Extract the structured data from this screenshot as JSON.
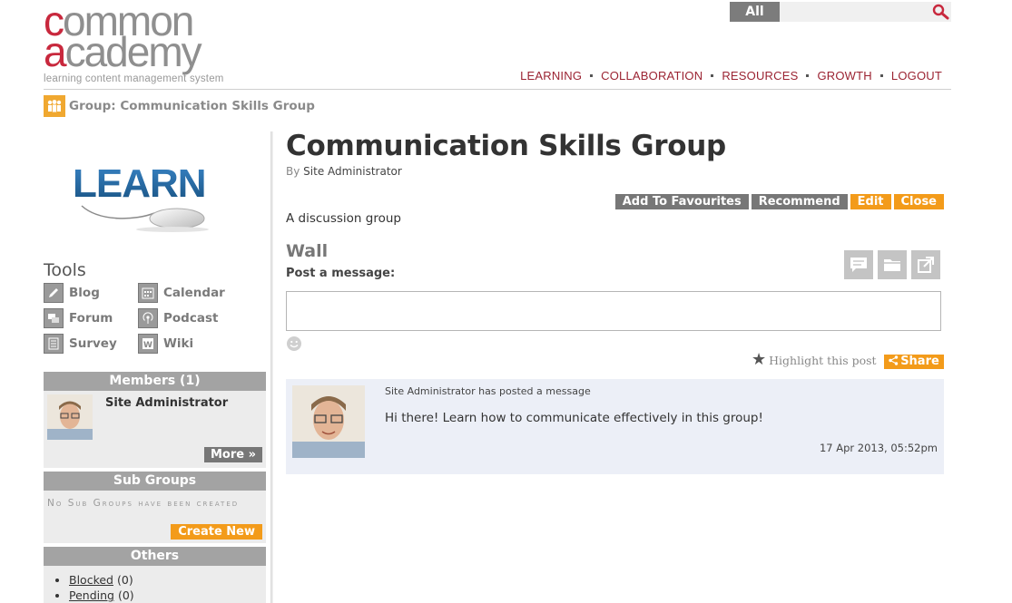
{
  "brand": {
    "logo_line1_initial": "c",
    "logo_line1_rest": "ommon",
    "logo_line2_initial": "a",
    "logo_line2_rest": "cademy",
    "tagline": "learning content management system",
    "accent_red": "#c8283d",
    "accent_orange": "#f39b1a"
  },
  "search": {
    "scope": "All",
    "value": "",
    "placeholder": ""
  },
  "nav": {
    "learning": "LEARNING",
    "collaboration": "COLLABORATION",
    "resources": "RESOURCES",
    "growth": "GROWTH",
    "logout": "LOGOUT"
  },
  "breadcrumb": {
    "text": "Group: Communication Skills Group",
    "icon": "group-icon"
  },
  "sidebar": {
    "banner_icon": "learn-mouse-banner",
    "tools_title": "Tools",
    "tools": [
      {
        "label": "Blog",
        "icon": "blog-icon"
      },
      {
        "label": "Calendar",
        "icon": "calendar-icon"
      },
      {
        "label": "Forum",
        "icon": "forum-icon"
      },
      {
        "label": "Podcast",
        "icon": "podcast-icon"
      },
      {
        "label": "Survey",
        "icon": "survey-icon"
      },
      {
        "label": "Wiki",
        "icon": "wiki-icon"
      }
    ],
    "members": {
      "title": "Members (1)",
      "name": "Site Administrator",
      "more": "More »"
    },
    "subgroups": {
      "title": "Sub Groups",
      "empty": "No Sub Groups have been created",
      "create": "Create New"
    },
    "others": {
      "title": "Others",
      "items": [
        {
          "label": "Blocked",
          "count": "(0)"
        },
        {
          "label": "Pending",
          "count": "(0)"
        }
      ]
    }
  },
  "main": {
    "title": "Communication Skills Group",
    "by_prefix": "By",
    "author": "Site Administrator",
    "actions": {
      "favourites": "Add To Favourites",
      "recommend": "Recommend",
      "edit": "Edit",
      "close": "Close"
    },
    "description": "A discussion group",
    "wall_title": "Wall",
    "post_label": "Post a message:",
    "message_value": "",
    "wall_icons": [
      "comment-icon",
      "folder-icon",
      "external-link-icon"
    ],
    "highlight": "Highlight this post",
    "share": "Share"
  },
  "post": {
    "meta": "Site Administrator has posted a message",
    "text": "Hi there! Learn how to communicate effectively in this group!",
    "time": "17 Apr 2013, 05:52pm"
  }
}
